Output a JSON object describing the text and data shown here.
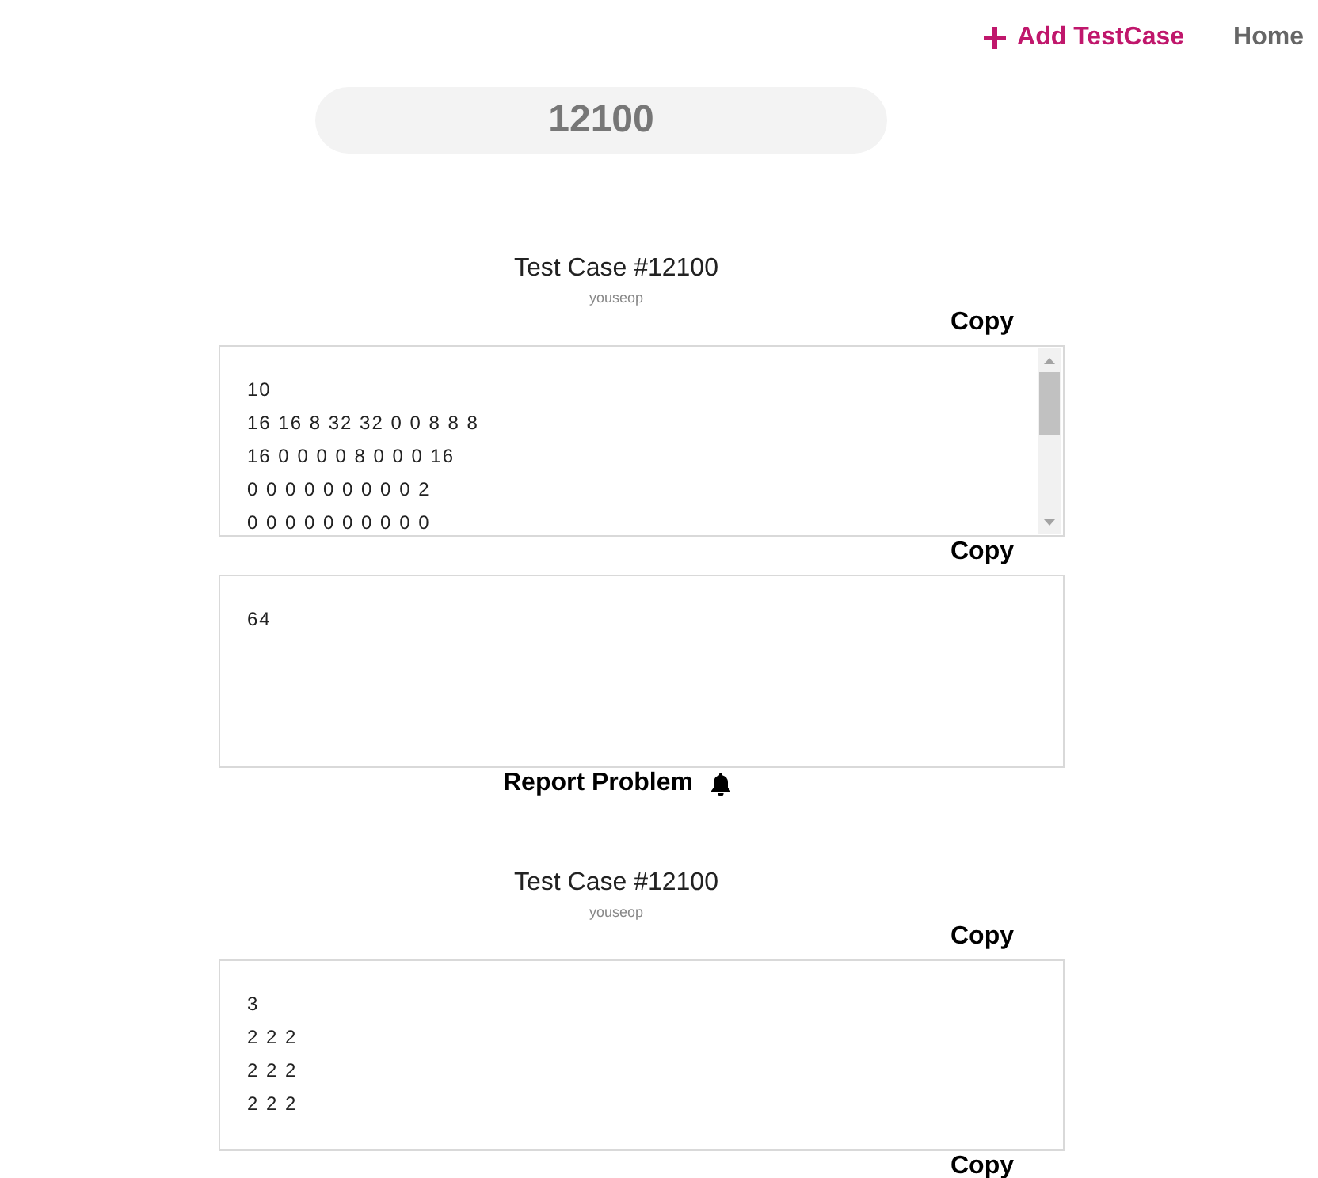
{
  "nav": {
    "add_link": "Add TestCase",
    "home_link": "Home"
  },
  "search": {
    "value": "12100"
  },
  "test_cases": [
    {
      "title": "Test Case #12100",
      "author": "youseop",
      "input": {
        "copy_label": "Copy",
        "lines": [
          "10",
          "16 16 8 32 32 0 0 8 8 8",
          "16 0 0 0 0 8 0 0 0 16",
          "0 0 0 0 0 0 0 0 0 2",
          "0 0 0 0 0 0 0 0 0 0"
        ],
        "scrollable": true
      },
      "output": {
        "copy_label": "Copy",
        "lines": [
          "64"
        ],
        "scrollable": false
      },
      "report_label": "Report Problem"
    },
    {
      "title": "Test Case #12100",
      "author": "youseop",
      "input": {
        "copy_label": "Copy",
        "lines": [
          "3",
          "2 2 2",
          "2 2 2",
          "2 2 2"
        ],
        "scrollable": false
      },
      "output": {
        "copy_label": "Copy"
      }
    }
  ]
}
